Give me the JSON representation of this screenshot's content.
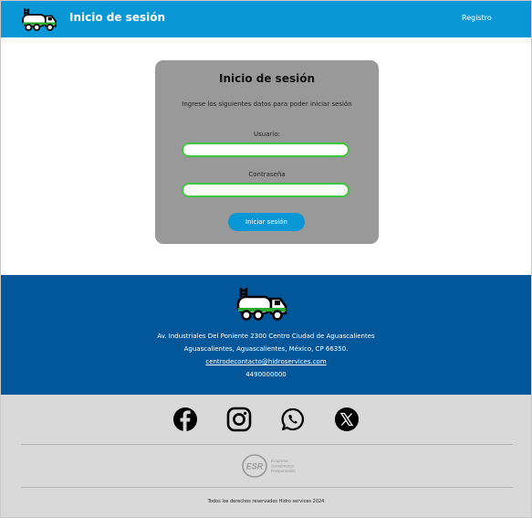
{
  "header": {
    "title": "Inicio de sesión",
    "register_link": "Registro"
  },
  "login": {
    "title": "Inicio de sesión",
    "subtitle": "Ingrese los siguientes datos para poder iniciar sesión",
    "user_label": "Usuario:",
    "user_value": "",
    "password_label": "Contraseña",
    "password_value": "",
    "submit_label": "Iniciar sesión"
  },
  "contact": {
    "address_line1": "Av. Industriales Del Poniente 2300 Centro Ciudad de Aguascalientes",
    "address_line2": "Aguascalientes, Aguascalientes, México, CP 66350.",
    "email": "centrodecontacto@hidroservices.com",
    "phone": "4490000000"
  },
  "social": [
    {
      "icon": "facebook-icon"
    },
    {
      "icon": "instagram-icon"
    },
    {
      "icon": "whatsapp-icon"
    },
    {
      "icon": "x-icon"
    }
  ],
  "esr": {
    "badge": "ESR",
    "line1": "Empresa",
    "line2": "Socialmente",
    "line3": "Responsable"
  },
  "copyright": "Todos los derechos reservados Hidro services 2024",
  "colors": {
    "header_blue": "#0a97d6",
    "footer_blue": "#02579b",
    "footer_gray": "#d9d9d9",
    "card_gray": "#999999",
    "field_border": "#3ec73e"
  }
}
